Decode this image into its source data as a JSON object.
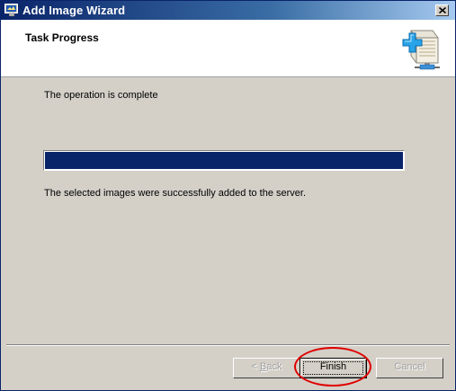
{
  "window": {
    "title": "Add Image Wizard",
    "close_glyph": "x"
  },
  "header": {
    "heading": "Task Progress",
    "icon": "add-image-server-icon"
  },
  "content": {
    "status_text": "The operation is complete",
    "progress": {
      "percent": 100,
      "color": "#0a246a"
    },
    "message": "The selected images were successfully added to the server."
  },
  "buttons": {
    "back": {
      "prefix": "< ",
      "accel": "B",
      "rest": "ack",
      "enabled": false
    },
    "finish": {
      "label": "Finish",
      "enabled": true,
      "default": true
    },
    "cancel": {
      "label": "Cancel",
      "enabled": false
    }
  },
  "annotation": {
    "shape": "ellipse",
    "color": "#e00000",
    "target": "finish"
  }
}
